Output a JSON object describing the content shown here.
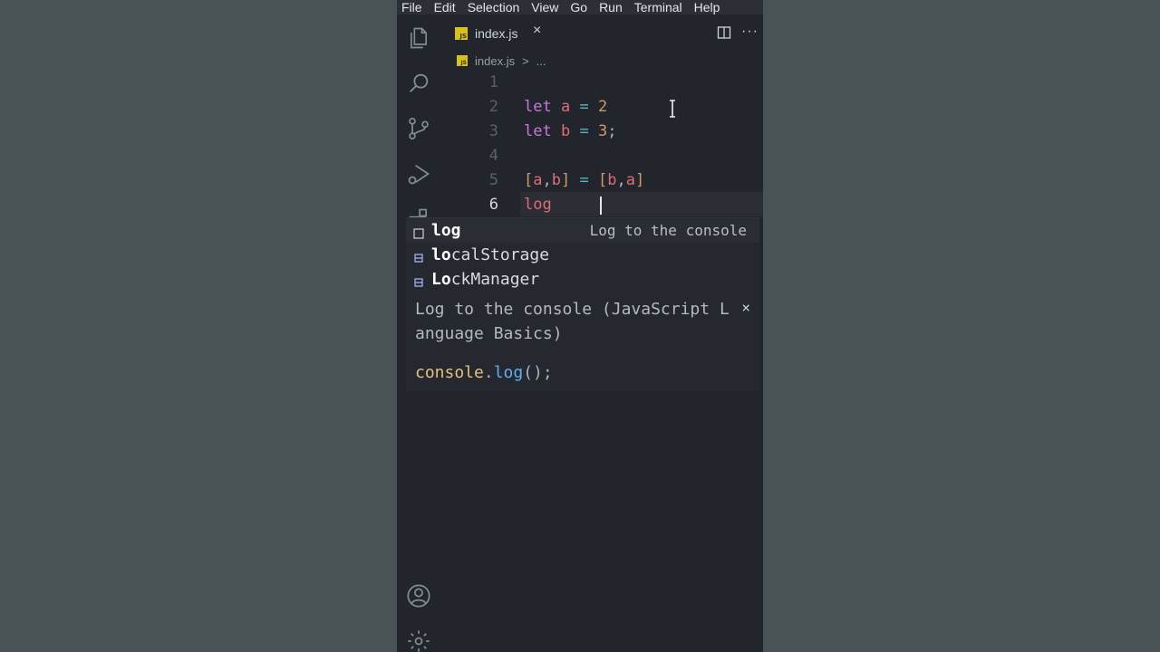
{
  "menu": {
    "items": [
      "File",
      "Edit",
      "Selection",
      "View",
      "Go",
      "Run",
      "Terminal",
      "Help"
    ]
  },
  "activity_bar": {
    "icons": [
      "explorer-icon",
      "search-icon",
      "source-control-icon",
      "run-debug-icon",
      "extensions-icon",
      "accounts-icon",
      "manage-gear-icon"
    ]
  },
  "tab": {
    "file_badge": "JS",
    "label": "index.js",
    "close": "×",
    "more": "···"
  },
  "breadcrumb": {
    "file": "index.js",
    "separator": ">",
    "more": "..."
  },
  "code": {
    "lines": [
      {
        "num": "1",
        "tokens": []
      },
      {
        "num": "2",
        "tokens": [
          [
            "let",
            "kw"
          ],
          [
            " ",
            "punc"
          ],
          [
            "a",
            "var"
          ],
          [
            " ",
            "punc"
          ],
          [
            "=",
            "op"
          ],
          [
            " ",
            "punc"
          ],
          [
            "2",
            "num"
          ]
        ]
      },
      {
        "num": "3",
        "tokens": [
          [
            "let",
            "kw"
          ],
          [
            " ",
            "punc"
          ],
          [
            "b",
            "var"
          ],
          [
            " ",
            "punc"
          ],
          [
            "=",
            "op"
          ],
          [
            " ",
            "punc"
          ],
          [
            "3",
            "num"
          ],
          [
            ";",
            "punc"
          ]
        ]
      },
      {
        "num": "4",
        "tokens": []
      },
      {
        "num": "5",
        "tokens": [
          [
            "[",
            "brk"
          ],
          [
            "a",
            "var"
          ],
          [
            ",",
            "punc"
          ],
          [
            "b",
            "var"
          ],
          [
            "]",
            "brk"
          ],
          [
            " ",
            "punc"
          ],
          [
            "=",
            "op"
          ],
          [
            " ",
            "punc"
          ],
          [
            "[",
            "brk"
          ],
          [
            "b",
            "var"
          ],
          [
            ",",
            "punc"
          ],
          [
            "a",
            "var"
          ],
          [
            "]",
            "brk"
          ]
        ]
      },
      {
        "num": "6",
        "tokens": [
          [
            "log",
            "var"
          ]
        ]
      }
    ],
    "active_line": 6
  },
  "suggestions": [
    {
      "match": "log",
      "rest": "",
      "detail": "Log to the console",
      "icon": "snippet-icon",
      "selected": true
    },
    {
      "match": "lo",
      "rest": "calStorage",
      "detail": "",
      "icon": "variable-icon",
      "selected": false
    },
    {
      "match": "Lo",
      "rest": "ckManager",
      "detail": "",
      "icon": "variable-icon",
      "selected": false
    }
  ],
  "details": {
    "description": "Log to the console (JavaScript Language Basics)",
    "close": "×",
    "code_object": "console",
    "code_dot": ".",
    "code_fn": "log",
    "code_tail": "();"
  },
  "colors": {
    "background": "#485356",
    "editor": "#22252b",
    "keyword": "#c678dd",
    "variable": "#e06c75",
    "number": "#d19a66",
    "js_badge": "#d7c21a"
  }
}
